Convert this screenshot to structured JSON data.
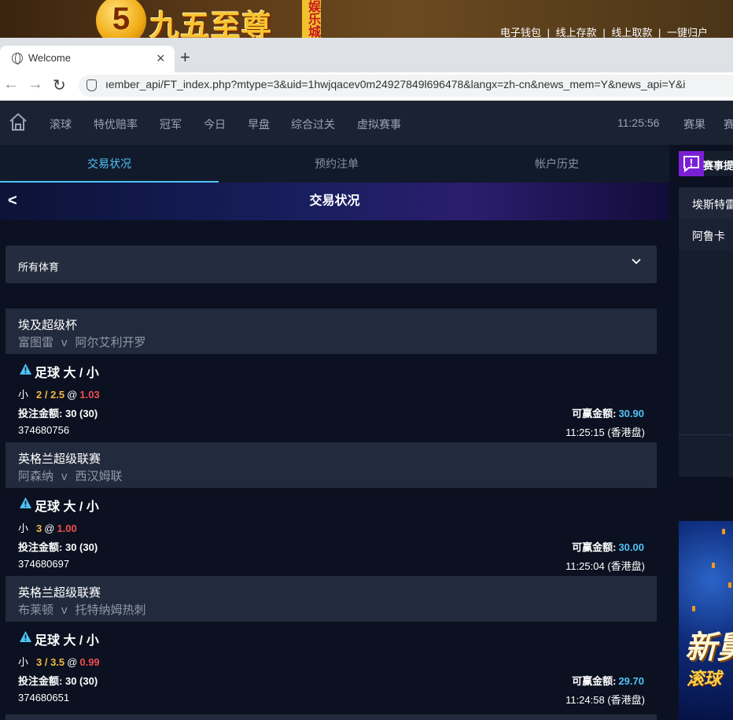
{
  "banner": {
    "logo_mark": "5",
    "logo_text": "九五至尊",
    "logo_tag": "娱乐城",
    "links": [
      "电子钱包",
      "线上存款",
      "线上取款",
      "一键归户"
    ],
    "separator": "|"
  },
  "browser": {
    "tab_title": "Welcome",
    "tab_close": "×",
    "new_tab": "+",
    "back": "←",
    "forward": "→",
    "reload": "↻",
    "url": "ıember_api/FT_index.php?mtype=3&uid=1hwjqacev0m24927849l696478&langx=zh-cn&news_mem=Y&news_api=Y&i"
  },
  "appnav": {
    "items": [
      "滚球",
      "特优赔率",
      "冠军",
      "今日",
      "早盘",
      "综合过关",
      "虚拟赛事"
    ],
    "time": "11:25:56",
    "results": "赛果",
    "cut": "赛"
  },
  "subtabs": [
    "交易状况",
    "预约注单",
    "帐户历史"
  ],
  "header": {
    "back": "<",
    "title": "交易状况"
  },
  "filter": {
    "label": "所有体育"
  },
  "bets": [
    {
      "league": "埃及超级杯",
      "home": "富图雷",
      "vs": "v",
      "away": "阿尔艾利开罗",
      "type": "足球 大 / 小",
      "side": "小",
      "line": "2 / 2.5",
      "at": "@",
      "odds": "1.03",
      "stake_label": "投注金额:",
      "stake": "30 (30)",
      "win_label": "可赢金额:",
      "win": "30.90",
      "ticket": "374680756",
      "time": "11:25:15 (香港盘)"
    },
    {
      "league": "英格兰超级联赛",
      "home": "阿森纳",
      "vs": "v",
      "away": "西汉姆联",
      "type": "足球 大 / 小",
      "side": "小",
      "line": "3",
      "at": "@",
      "odds": "1.00",
      "stake_label": "投注金额:",
      "stake": "30 (30)",
      "win_label": "可赢金额:",
      "win": "30.00",
      "ticket": "374680697",
      "time": "11:25:04 (香港盘)"
    },
    {
      "league": "英格兰超级联赛",
      "home": "布莱顿",
      "vs": "v",
      "away": "托特纳姆热刺",
      "type": "足球 大 / 小",
      "side": "小",
      "line": "3 / 3.5",
      "at": "@",
      "odds": "0.99",
      "stake_label": "投注金额:",
      "stake": "30 (30)",
      "win_label": "可赢金额:",
      "win": "29.70",
      "ticket": "374680651",
      "time": "11:24:58 (香港盘)"
    }
  ],
  "right_panel": {
    "title": "赛事提",
    "rows": [
      "埃斯特雷",
      "阿鲁卡"
    ],
    "promo_line1": "新舅",
    "promo_line2": "滚球"
  },
  "colors": {
    "accent": "#4fc3f7",
    "line": "#f5b942",
    "odds": "#ef4d4d",
    "panel": "#222b3d",
    "bg": "#0b1120"
  }
}
